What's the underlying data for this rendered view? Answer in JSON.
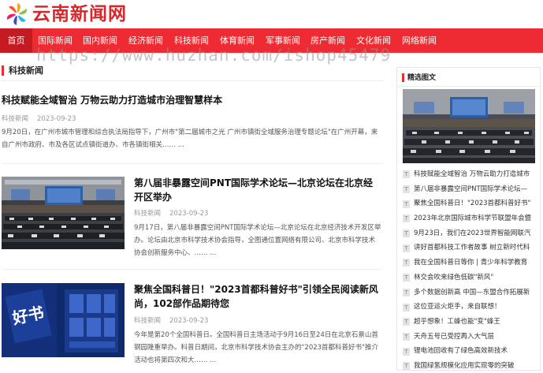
{
  "site": {
    "title": "云南新闻网"
  },
  "watermark": "https://www.huzhan.com/ishop45479",
  "nav": {
    "items": [
      {
        "label": "首页",
        "active": true
      },
      {
        "label": "国际新闻",
        "active": false
      },
      {
        "label": "国内新闻",
        "active": false
      },
      {
        "label": "经济新闻",
        "active": false
      },
      {
        "label": "科技新闻",
        "active": false
      },
      {
        "label": "体育新闻",
        "active": false
      },
      {
        "label": "军事新闻",
        "active": false
      },
      {
        "label": "房产新闻",
        "active": false
      },
      {
        "label": "文化新闻",
        "active": false
      },
      {
        "label": "网络新闻",
        "active": false
      }
    ]
  },
  "section": {
    "title": "科技新闻"
  },
  "articles": [
    {
      "title": "科技赋能全域智治 万物云助力打造城市治理智慧样本",
      "category": "科技新闻",
      "date": "2023-09-23",
      "summary": "9月20日，在广州市城市管理和综合执法局指导下，广州市\"第二届城市之光 广州市镇街全域服务治理专题论坛\"在广州开幕，来自广州市政府、市及各区试点镇街道办、市各镇街相关……  ..."
    },
    {
      "title": "第八届非暴露空间PNT国际学术论坛—北京论坛在北京经开区举办",
      "category": "科技新闻",
      "date": "2023-09-23",
      "summary": "9月17日，第八届非暴露空间PNT国际学术论坛—北京论坛在北京经济技术开发区举办。论坛由北京市科学技术协会指导，全图通位置网络有限公司、北京市科学技术协会创新服务中心、……  ..."
    },
    {
      "title": "聚焦全国科普日！\"2023首都科普好书\"引领全民阅读新风尚，102部作品期待您",
      "category": "科技新闻",
      "date": "2023-09-23",
      "summary": "今年是第20个全国科普日。全国科普日主场活动于9月16日至24日在北京石景山首钢园隆重举办。科普日期间，北京市科学技术协会主办的\"2023首都科普好书\"推介活动也将第四次和大……  ..."
    }
  ],
  "sidebar": {
    "title": "精选图文",
    "badge": "T",
    "items": [
      "科技赋能全域智治 万物云助力打造城市",
      "第八届非暴露空间PNT国际学术论坛—",
      "聚焦全国科普日！\"2023首都科普好书\"",
      "2023年北京国际城市科学节联盟年会暨",
      "9月23日，我们在2023世界智能网联汽",
      "讲好首都科技工作者故事 树立新时代科",
      "我在全国科普日等你 | 青少年科学教育",
      "林交会吹来绿色低碳\"新风\"",
      "多个数据创新高 中国—东盟合作拓展新",
      "这位亚运火炬手，来自联想！",
      "超乎想象！工蜂也能\"变\"蜂王",
      "天舟五号已受控再入大气层",
      "锂电池回收有了绿色高效新技术",
      "我国绿氢规模化应用实现零的突破"
    ]
  },
  "colors": {
    "brand_red": "#ee2b32",
    "active_red": "#c41a21"
  },
  "icons": {
    "logo": "pinwheel-logo-icon"
  }
}
